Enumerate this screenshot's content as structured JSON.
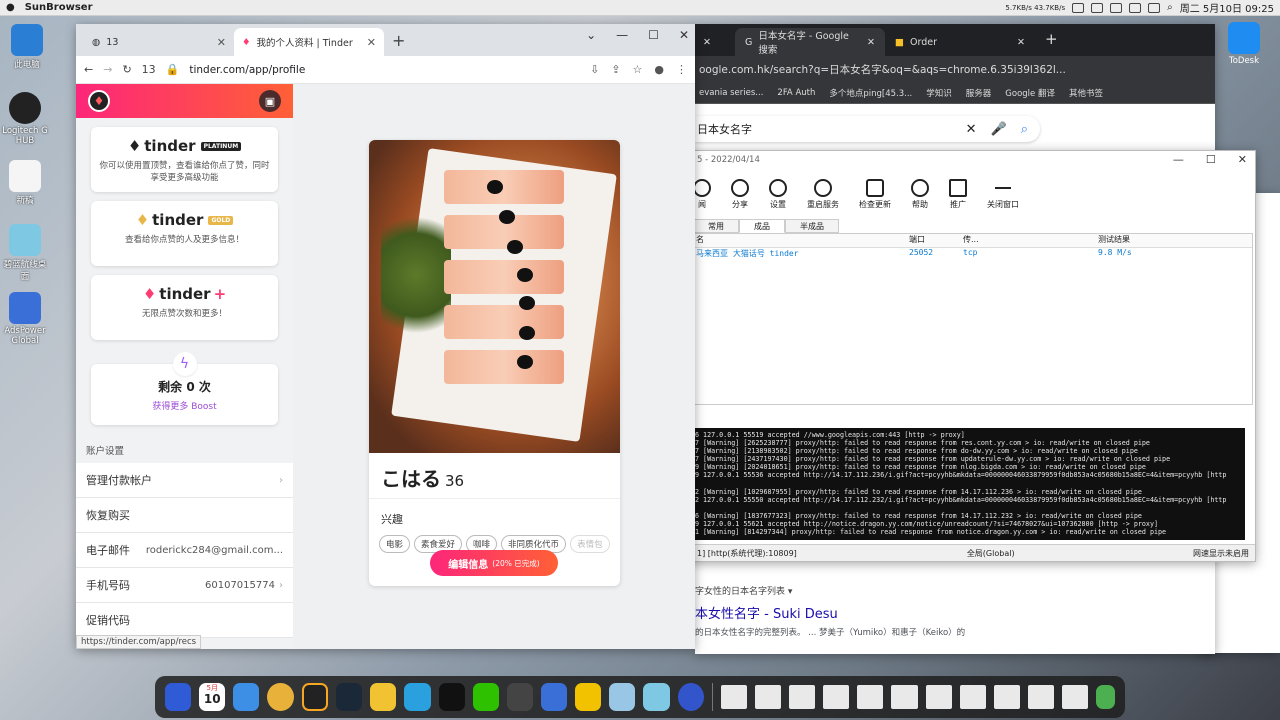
{
  "menubar": {
    "app": "SunBrowser",
    "net": "5.7KB/s 43.7KB/s",
    "date": "周二 5月10日 09:25"
  },
  "desktop_icons": [
    {
      "label": "此电脑",
      "color": "#2a7fd4"
    },
    {
      "label": "Logitech G HUB",
      "color": "#222222"
    },
    {
      "label": "新稿",
      "color": "#f0f0f0"
    },
    {
      "label": "碧蓝航线桌面",
      "color": "#7ec8e3"
    },
    {
      "label": "AdsPower Global",
      "color": "#3a6fd8"
    }
  ],
  "tinder_window": {
    "tabs": [
      {
        "label": "13",
        "icon": "globe-icon"
      },
      {
        "label": "我的个人资料 | Tinder",
        "icon": "tinder-flame-icon"
      }
    ],
    "address": {
      "page_num": "13",
      "url": "tinder.com/app/profile"
    },
    "sidebar": {
      "cards": [
        {
          "brand": "tinder",
          "tier": "PLATINUM",
          "desc": "你可以使用置顶赞，查看谁给你点了赞，同时享受更多高级功能"
        },
        {
          "brand": "tinder",
          "tier": "GOLD",
          "desc": "查看给你点赞的人及更多信息！"
        },
        {
          "brand": "tinder",
          "tier": "+",
          "desc": "无限点赞次数和更多！"
        }
      ],
      "boost": {
        "count": "剩余 0 次",
        "more": "获得更多 Boost"
      },
      "section_title": "账户设置",
      "rows": [
        {
          "label": "管理付款帐户",
          "value": ""
        },
        {
          "label": "恢复购买",
          "value": ""
        },
        {
          "label": "电子邮件",
          "value": "roderickc284@gmail.com..."
        },
        {
          "label": "手机号码",
          "value": "60107015774"
        },
        {
          "label": "促销代码",
          "value": ""
        }
      ],
      "status_url": "https://tinder.com/app/recs"
    },
    "profile": {
      "name": "こはる",
      "age": "36",
      "interests_title": "兴趣",
      "interests": [
        "电影",
        "素食爱好",
        "咖啡",
        "非同质化代币",
        "表情包"
      ],
      "edit_label": "编辑信息",
      "edit_progress": "(20% 已完成)"
    }
  },
  "google_window": {
    "tabs": [
      {
        "label": "日本女名字 - Google 搜索"
      },
      {
        "label": "Order"
      }
    ],
    "url": "oogle.com.hk/search?q=日本女名字&oq=&aqs=chrome.6.35i39l362l...",
    "bookmarks": [
      "evania series...",
      "2FA Auth",
      "多个地点ping[45.3...",
      "学知识",
      "服务器",
      "Google 翻译",
      "其他书签"
    ],
    "search_text": "日本女名字",
    "result": {
      "category": "字女性的日本名字列表 ▾",
      "title": "本女性名字 - Suki Desu",
      "snippet": "的日本女性名字的完整列表。 ... 梦美子（Yumiko）和惠子（Keiko）的"
    }
  },
  "proxy_window": {
    "title": "5 - 2022/04/14",
    "toolbar": [
      "闻",
      "分享",
      "设置",
      "重启服务",
      "检查更新",
      "帮助",
      "推广",
      "关闭窗口"
    ],
    "tabs": [
      "常用",
      "成品",
      "半成品"
    ],
    "headers": [
      "名",
      "端口",
      "传...",
      "测试结果"
    ],
    "rows": [
      {
        "name": "马来西亚 大猫话号 tinder",
        "port": "25052",
        "proto": "tcp",
        "result": "9.8 M/s"
      }
    ],
    "log": [
      "6 127.0.0.1 55519 accepted //www.googleapis.com:443 [http -> proxy]",
      "7 [Warning] [2625238777] proxy/http: failed to read response from res.cont.yy.com > io: read/write on closed pipe",
      "7 [Warning] [2138983502] proxy/http: failed to read response from do-dw.yy.com > io: read/write on closed pipe",
      "7 [Warning] [2437197430] proxy/http: failed to read response from updaterule-dw.yy.com > io: read/write on closed pipe",
      "9 [Warning] [2024018651] proxy/http: failed to read response from nlog.bigda.com > io: read/write on closed pipe",
      "9 127.0.0.1 55536 accepted http://14.17.112.236/i.gif?act=pcyyhb&mkdata=000000046033879959f0db853a4c05680b15a8EC=4&item=pcyyhb [http",
      "",
      "2 [Warning] [1029687955] proxy/http: failed to read response from 14.17.112.236 > io: read/write on closed pipe",
      "2 127.0.0.1 55550 accepted http://14.17.112.232/i.gif?act=pcyyhb&mkdata=000000046033879959f0db853a4c05680b15a8EC=4&item=pcyyhb [http",
      "",
      "6 [Warning] [1837677323] proxy/http: failed to read response from 14.17.112.232 > io: read/write on closed pipe",
      "9 127.0.0.1 55621 accepted http://notice.dragon.yy.com/notice/unreadcount/?si=74678027&ui=107362800 [http -> proxy]",
      "1 [Warning] [814297344] proxy/http: failed to read response from notice.dragon.yy.com > io: read/write on closed pipe"
    ],
    "status": {
      "left": "1] [http(系统代理):10809]",
      "mid": "全局(Global)",
      "right": "网速显示未启用"
    }
  },
  "todesk_label": "ToDesk",
  "dock": {
    "date_month": "5月",
    "date_day": "10"
  }
}
